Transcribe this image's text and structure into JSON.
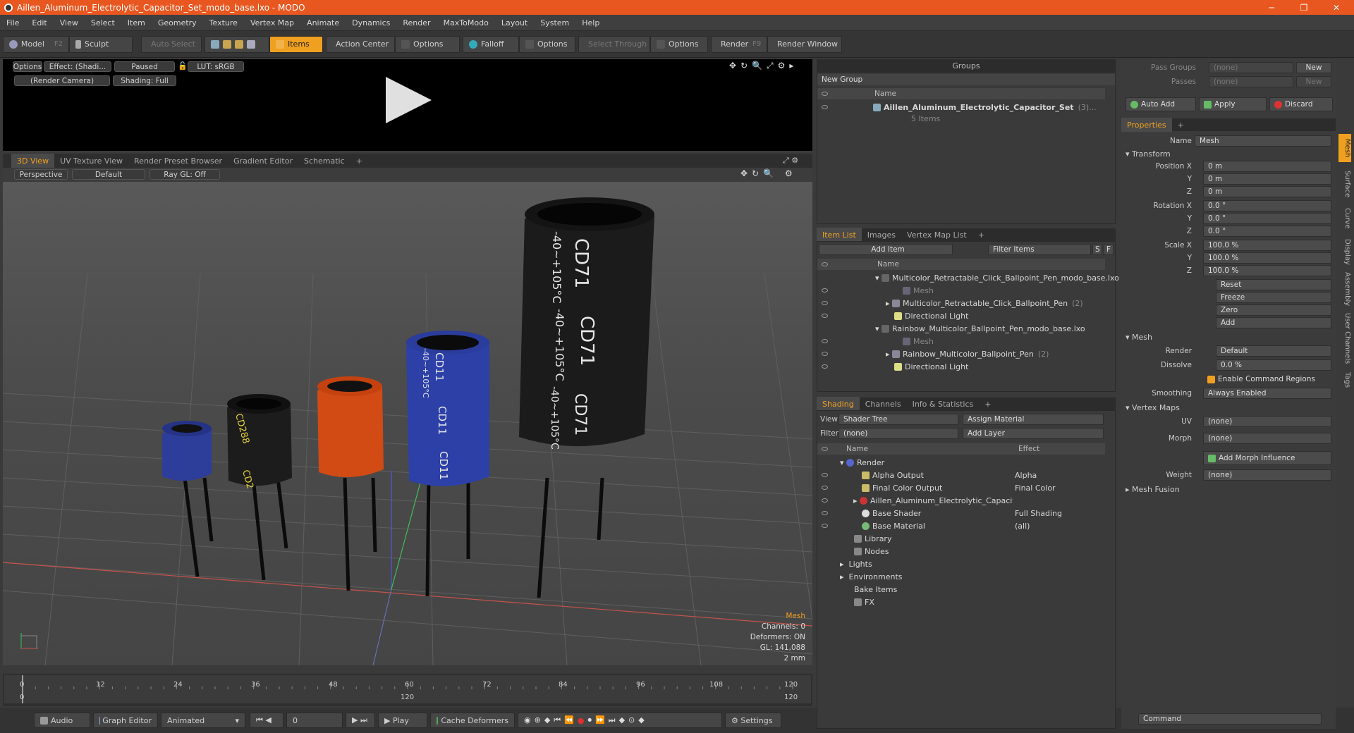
{
  "window": {
    "title": "Aillen_Aluminum_Electrolytic_Capacitor_Set_modo_base.lxo - MODO",
    "min": "─",
    "max": "❐",
    "close": "✕"
  },
  "menu": [
    "File",
    "Edit",
    "View",
    "Select",
    "Item",
    "Geometry",
    "Texture",
    "Vertex Map",
    "Animate",
    "Dynamics",
    "Render",
    "MaxToModo",
    "Layout",
    "System",
    "Help"
  ],
  "toolbar": {
    "model": "Model",
    "model_key": "F2",
    "sculpt": "Sculpt",
    "auto_select": "Auto Select",
    "items": "Items",
    "action_center": "Action Center",
    "options1": "Options",
    "falloff": "Falloff",
    "options2": "Options",
    "select_through": "Select Through",
    "options3": "Options",
    "render": "Render",
    "render_key": "F9",
    "render_window": "Render Window"
  },
  "preview": {
    "options": "Options",
    "effect": "Effect: (Shadi...",
    "paused": "Paused",
    "lut": "LUT: sRGB",
    "camera": "(Render Camera)",
    "shading": "Shading: Full"
  },
  "viewtabs": [
    "3D View",
    "UV Texture View",
    "Render Preset Browser",
    "Gradient Editor",
    "Schematic",
    "+"
  ],
  "viewport": {
    "perspective": "Perspective",
    "default": "Default",
    "raygl": "Ray GL: Off"
  },
  "info3d": {
    "mesh": "Mesh",
    "channels": "Channels: 0",
    "deformers": "Deformers: ON",
    "gl": "GL: 141,088",
    "unit": "2 mm"
  },
  "timeline": {
    "ticks": [
      "0",
      "12",
      "24",
      "36",
      "48",
      "60",
      "72",
      "84",
      "96",
      "108",
      "120"
    ],
    "left": "0",
    "mid": "120",
    "right": "120"
  },
  "bottombar": {
    "audio": "Audio",
    "graph": "Graph Editor",
    "animated": "Animated",
    "frame": "0",
    "play": "Play",
    "cache": "Cache Deformers",
    "settings": "Settings"
  },
  "groups": {
    "title": "Groups",
    "new_group": "New Group",
    "col_name": "Name",
    "item": "Aillen_Aluminum_Electrolytic_Capacitor_Set",
    "item_count": "(3)...",
    "items_sub": "5 Items"
  },
  "itemlist": {
    "tabs": [
      "Item List",
      "Images",
      "Vertex Map List",
      "+"
    ],
    "add_item": "Add Item",
    "filter": "Filter Items",
    "s": "S",
    "f": "F",
    "col_name": "Name",
    "rows": [
      {
        "label": "Multicolor_Retractable_Click_Ballpoint_Pen_modo_base.lxo",
        "sub": ""
      },
      {
        "label": "Mesh",
        "sub": ""
      },
      {
        "label": "Multicolor_Retractable_Click_Ballpoint_Pen",
        "sub": "(2)"
      },
      {
        "label": "Directional Light",
        "sub": ""
      },
      {
        "label": "Rainbow_Multicolor_Ballpoint_Pen_modo_base.lxo",
        "sub": ""
      },
      {
        "label": "Mesh",
        "sub": ""
      },
      {
        "label": "Rainbow_Multicolor_Ballpoint_Pen",
        "sub": "(2)"
      },
      {
        "label": "Directional Light",
        "sub": ""
      }
    ]
  },
  "shading": {
    "tabs": [
      "Shading",
      "Channels",
      "Info & Statistics",
      "+"
    ],
    "view_lbl": "View",
    "view": "Shader Tree",
    "assign": "Assign Material",
    "filter_lbl": "Filter",
    "filter": "(none)",
    "add_layer": "Add Layer",
    "col_name": "Name",
    "col_effect": "Effect",
    "rows": [
      {
        "name": "Render",
        "effect": ""
      },
      {
        "name": "Alpha Output",
        "effect": "Alpha"
      },
      {
        "name": "Final Color Output",
        "effect": "Final Color"
      },
      {
        "name": "Aillen_Aluminum_Electrolytic_Capacitor ...",
        "effect": ""
      },
      {
        "name": "Base Shader",
        "effect": "Full Shading"
      },
      {
        "name": "Base Material",
        "effect": "(all)"
      },
      {
        "name": "Library",
        "effect": ""
      },
      {
        "name": "Nodes",
        "effect": ""
      },
      {
        "name": "Lights",
        "effect": ""
      },
      {
        "name": "Environments",
        "effect": ""
      },
      {
        "name": "Bake Items",
        "effect": ""
      },
      {
        "name": "FX",
        "effect": ""
      }
    ]
  },
  "props": {
    "pass_groups": "Pass Groups",
    "pass_val": "(none)",
    "new": "New",
    "passes": "Passes",
    "passes_val": "(none)",
    "new2": "New",
    "auto_add": "Auto Add",
    "apply": "Apply",
    "discard": "Discard",
    "tab": "Properties",
    "name_lbl": "Name",
    "name": "Mesh",
    "transform": "Transform",
    "pos_x_lbl": "Position X",
    "pos_x": "0 m",
    "y": "Y",
    "pos_y": "0 m",
    "z": "Z",
    "pos_z": "0 m",
    "rot_x_lbl": "Rotation X",
    "rot_x": "0.0 °",
    "rot_y": "0.0 °",
    "rot_z": "0.0 °",
    "scl_x_lbl": "Scale X",
    "scl_x": "100.0 %",
    "scl_y": "100.0 %",
    "scl_z": "100.0 %",
    "reset": "Reset",
    "freeze": "Freeze",
    "zero": "Zero",
    "add": "Add",
    "mesh": "Mesh",
    "render_lbl": "Render",
    "render": "Default",
    "dissolve_lbl": "Dissolve",
    "dissolve": "0.0 %",
    "ecr": "Enable Command Regions",
    "smoothing_lbl": "Smoothing",
    "smoothing": "Always Enabled",
    "vertex_maps": "Vertex Maps",
    "uv_lbl": "UV",
    "uv": "(none)",
    "morph_lbl": "Morph",
    "morph": "(none)",
    "add_morph": "Add Morph Influence",
    "weight_lbl": "Weight",
    "weight": "(none)",
    "mesh_fusion": "Mesh Fusion",
    "command": "Command"
  },
  "side_tabs": [
    "Mesh",
    "Surface",
    "Curve",
    "Display",
    "Assembly",
    "User Channels",
    "Tags"
  ],
  "colors": {
    "accent": "#f0a020",
    "titlebar": "#e8571f"
  }
}
